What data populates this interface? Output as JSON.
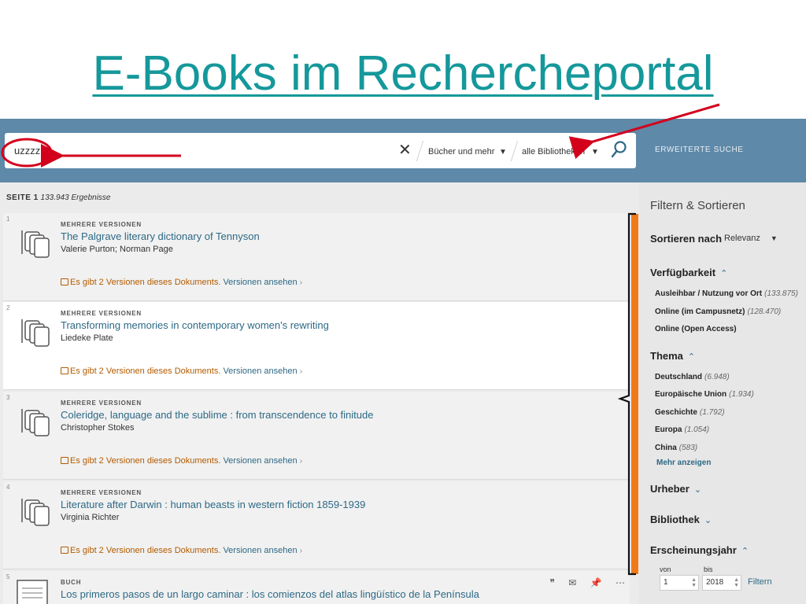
{
  "slide": {
    "title": "E-Books im Rechercheportal"
  },
  "search": {
    "query": "uzzzz",
    "clear_icon": "close-icon",
    "scope_label": "Bücher und mehr",
    "library_label": "alle Bibliotheken",
    "advanced_label": "ERWEITERTE SUCHE"
  },
  "results": {
    "page_label": "SEITE 1",
    "count_label": "133.943 Ergebnisse",
    "items": [
      {
        "num": "1",
        "kind": "MEHRERE VERSIONEN",
        "title": "The Palgrave literary dictionary of Tennyson",
        "author": "Valerie Purton; Norman Page",
        "versions_text": "Es gibt 2 Versionen dieses Dokuments.",
        "versions_link": "Versionen ansehen"
      },
      {
        "num": "2",
        "kind": "MEHRERE VERSIONEN",
        "title": "Transforming memories in contemporary women's rewriting",
        "author": "Liedeke Plate",
        "versions_text": "Es gibt 2 Versionen dieses Dokuments.",
        "versions_link": "Versionen ansehen"
      },
      {
        "num": "3",
        "kind": "MEHRERE VERSIONEN",
        "title": "Coleridge, language and the sublime : from transcendence to finitude",
        "author": "Christopher Stokes",
        "versions_text": "Es gibt 2 Versionen dieses Dokuments.",
        "versions_link": "Versionen ansehen"
      },
      {
        "num": "4",
        "kind": "MEHRERE VERSIONEN",
        "title": "Literature after Darwin : human beasts in western fiction 1859-1939",
        "author": "Virginia Richter",
        "versions_text": "Es gibt 2 Versionen dieses Dokuments.",
        "versions_link": "Versionen ansehen"
      },
      {
        "num": "5",
        "kind": "BUCH",
        "title": "Los primeros pasos de un largo caminar : los comienzos del atlas lingüístico de la Península"
      }
    ]
  },
  "sidebar": {
    "title": "Filtern & Sortieren",
    "sort_label": "Sortieren nach",
    "sort_value": "Relevanz",
    "availability": {
      "label": "Verfügbarkeit",
      "items": [
        {
          "label": "Ausleihbar / Nutzung vor Ort",
          "count": "(133.875)"
        },
        {
          "label": "Online (im Campusnetz)",
          "count": "(128.470)"
        },
        {
          "label": "Online (Open Access)",
          "count": ""
        }
      ]
    },
    "topic": {
      "label": "Thema",
      "items": [
        {
          "label": "Deutschland",
          "count": "(6.948)"
        },
        {
          "label": "Europäische Union",
          "count": "(1.934)"
        },
        {
          "label": "Geschichte",
          "count": "(1.792)"
        },
        {
          "label": "Europa",
          "count": "(1.054)"
        },
        {
          "label": "China",
          "count": "(583)"
        }
      ],
      "more": "Mehr anzeigen"
    },
    "creator_label": "Urheber",
    "library_label": "Bibliothek",
    "year": {
      "label": "Erscheinungsjahr",
      "from_label": "von",
      "to_label": "bis",
      "from_value": "1",
      "to_value": "2018",
      "filter_label": "Filtern"
    }
  },
  "colors": {
    "title": "#15989b",
    "topbar": "#5e89a9",
    "link": "#2d6985",
    "versions": "#b35b00",
    "annotation_red": "#d3001c",
    "annotation_orange": "#f07a1a"
  }
}
